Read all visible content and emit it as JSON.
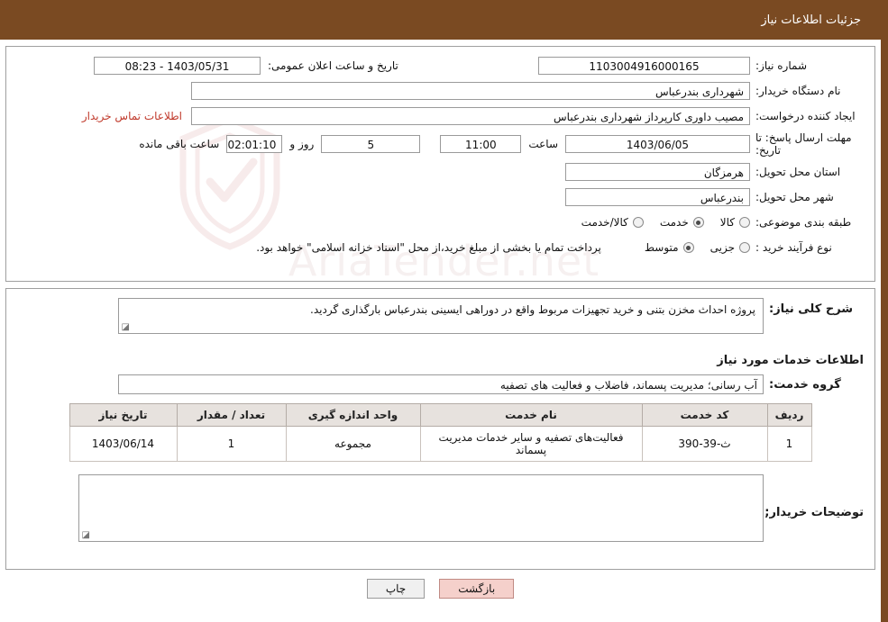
{
  "header": {
    "title": "جزئیات اطلاعات نیاز"
  },
  "watermark": {
    "text": "AriaTender.net"
  },
  "form": {
    "need_number_label": "شماره نیاز:",
    "need_number_value": "1103004916000165",
    "announce_datetime_label": "تاریخ و ساعت اعلان عمومی:",
    "announce_datetime_value": "1403/05/31 - 08:23",
    "buyer_org_label": "نام دستگاه خریدار:",
    "buyer_org_value": "شهرداری بندرعباس",
    "requester_label": "ایجاد کننده درخواست:",
    "requester_value": "مصیب داوری کارپرداز شهرداری بندرعباس",
    "contact_link": "اطلاعات تماس خریدار",
    "deadline_label": "مهلت ارسال پاسخ: تا تاریخ:",
    "deadline_date": "1403/06/05",
    "deadline_hour_label": "ساعت",
    "deadline_hour_value": "11:00",
    "days_value": "5",
    "days_label": "روز و",
    "remaining_value": "02:01:10",
    "remaining_label": "ساعت باقی مانده",
    "province_label": "استان محل تحویل:",
    "province_value": "هرمزگان",
    "city_label": "شهر محل تحویل:",
    "city_value": "بندرعباس",
    "category_label": "طبقه بندی موضوعی:",
    "category_options": [
      {
        "label": "کالا",
        "checked": false
      },
      {
        "label": "خدمت",
        "checked": true
      },
      {
        "label": "کالا/خدمت",
        "checked": false
      }
    ],
    "purchase_type_label": "نوع فرآیند خرید :",
    "purchase_type_options": [
      {
        "label": "جزیی",
        "checked": false
      },
      {
        "label": "متوسط",
        "checked": true
      }
    ],
    "purchase_note": "پرداخت تمام یا بخشی از مبلغ خرید،از محل \"اسناد خزانه اسلامی\" خواهد بود."
  },
  "description": {
    "label": "شرح کلی نیاز:",
    "value": "پروژه احداث مخزن بتنی و خرید تجهیزات مربوط واقع در دوراهی ایسینی بندرعباس  بارگذاری گردید."
  },
  "services": {
    "section_title": "اطلاعات خدمات مورد نیاز",
    "group_label": "گروه خدمت:",
    "group_value": "آب رسانی؛ مدیریت پسماند، فاضلاب و فعالیت های تصفیه",
    "columns": [
      "ردیف",
      "کد خدمت",
      "نام خدمت",
      "واحد اندازه گیری",
      "تعداد / مقدار",
      "تاریخ نیاز"
    ],
    "rows": [
      {
        "index": "1",
        "code": "ث-39-390",
        "name": "فعالیت‌های تصفیه و سایر خدمات مدیریت پسماند",
        "unit": "مجموعه",
        "quantity": "1",
        "date": "1403/06/14"
      }
    ]
  },
  "buyer_notes": {
    "label": "توضیحات خریدار;",
    "value": ""
  },
  "footer": {
    "print_label": "چاپ",
    "back_label": "بازگشت"
  }
}
